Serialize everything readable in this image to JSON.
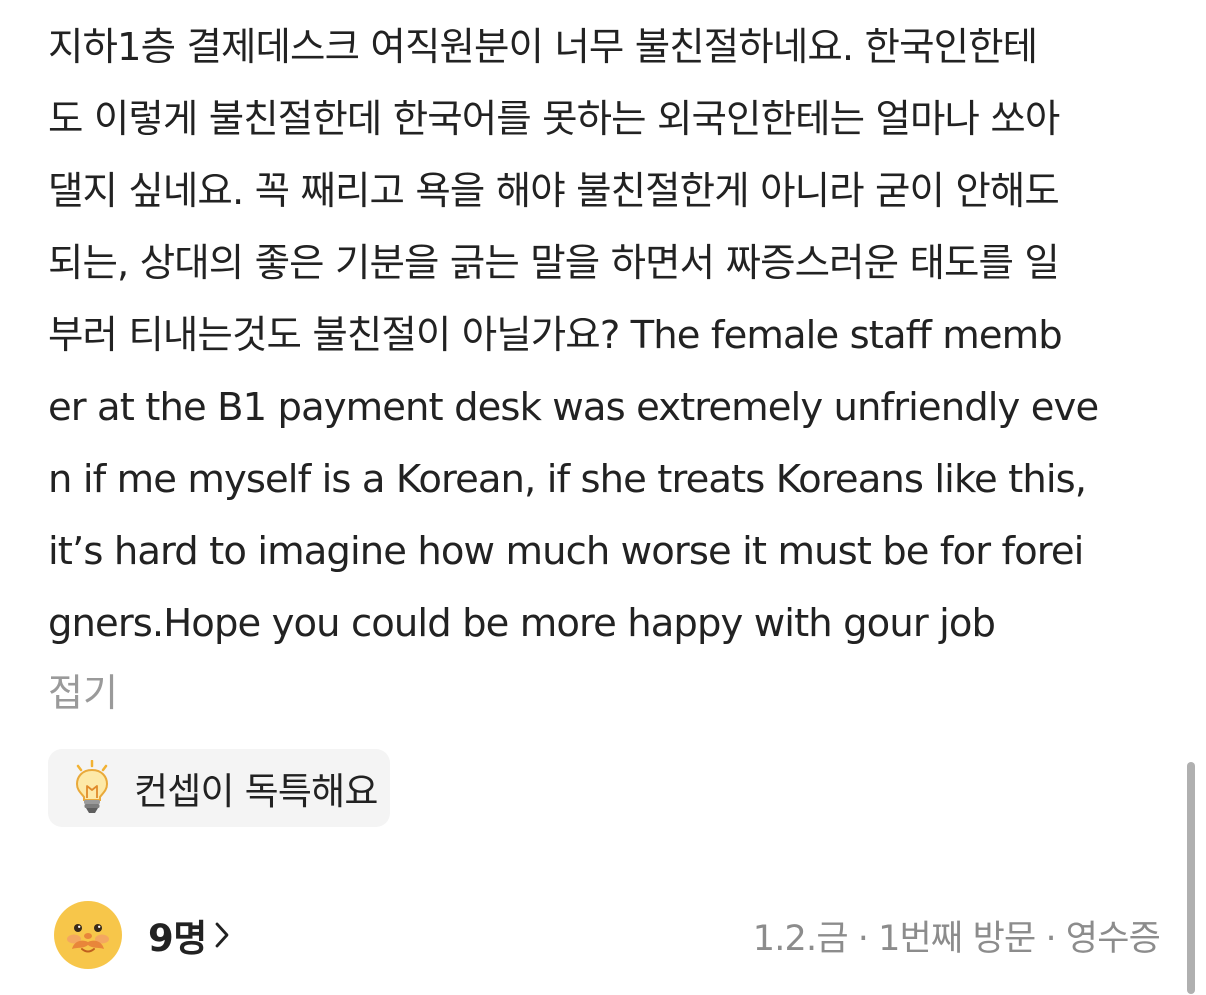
{
  "review": {
    "lines": [
      "지하1층 결제데스크 여직원분이 너무 불친절하네요. 한국인한테",
      "도 이렇게 불친절한데 한국어를 못하는 외국인한테는 얼마나 쏘아",
      "댈지 싶네요. 꼭 째리고 욕을 해야 불친절한게 아니라 굳이 안해도",
      "되는, 상대의 좋은 기분을 긁는 말을 하면서 짜증스러운 태도를 일",
      "부러 티내는것도 불친절이 아닐가요? The female staff memb",
      "er at the B1 payment desk was extremely unfriendly eve",
      "n if me myself is a Korean, if she treats Koreans like this,",
      "it’s hard to imagine how much worse it must be for forei",
      "gners.Hope you could be more happy with gour job"
    ],
    "collapse_label": "접기"
  },
  "keyword_chip": {
    "icon": "lightbulb-icon",
    "label": "컨셉이 독특해요"
  },
  "footer": {
    "reaction_count": "9명",
    "visit_date": "1.2.금",
    "visit_count": "1번째 방문",
    "receipt": "영수증",
    "separator": "·"
  },
  "colors": {
    "text": "#222222",
    "muted": "#8c8c8c",
    "chip_background": "#f4f4f4",
    "avatar_yellow": "#f7c64a",
    "avatar_orange": "#e8863a",
    "scrollbar": "#b0b0b0"
  }
}
